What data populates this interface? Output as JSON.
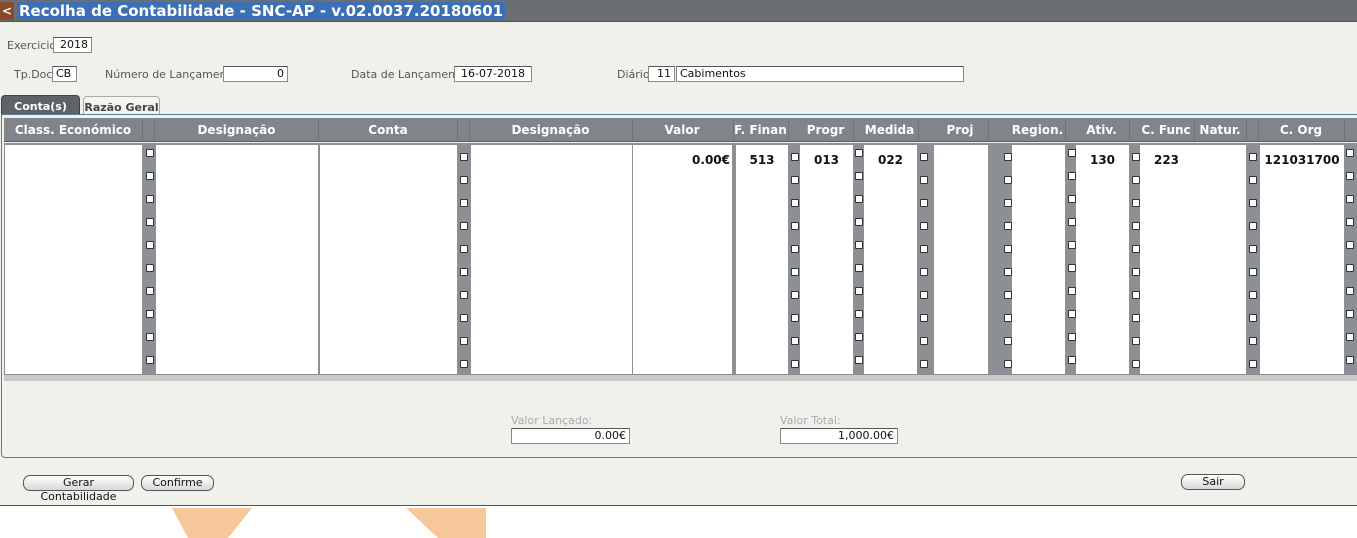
{
  "window": {
    "title": "Recolha de Contabilidade - SNC-AP - v.02.0037.20180601",
    "back_glyph": "<"
  },
  "form": {
    "exercicio_label": "Exercicio",
    "exercicio_value": "2018",
    "tpdoc_label": "Tp.Doc.",
    "tpdoc_value": "CB",
    "numero_label": "Número de Lançamento:",
    "numero_value": "0",
    "data_label": "Data de Lançamento:",
    "data_value": "16-07-2018",
    "diario_label": "Diário:",
    "diario_code": "11",
    "diario_name": "Cabimentos"
  },
  "tabs": [
    {
      "label": "Conta(s)",
      "active": true
    },
    {
      "label": "Razão Geral",
      "active": false
    }
  ],
  "grid": {
    "columns": [
      "Class. Económico",
      "Designação",
      "Conta",
      "Designação",
      "Valor",
      "F. Finan",
      "Progr",
      "Medida",
      "Proj",
      "Region.",
      "Ativ.",
      "C. Func",
      "Natur.",
      "C. Org"
    ],
    "row1": {
      "valor": "0.00€",
      "f_finan": "513",
      "progr": "013",
      "medida": "022",
      "ativ": "130",
      "c_func": "223",
      "c_org": "121031700"
    }
  },
  "totals": {
    "valor_lancado_label": "Valor Lançado:",
    "valor_lancado_value": "0.00€",
    "valor_total_label": "Valor Total:",
    "valor_total_value": "1,000.00€"
  },
  "buttons": {
    "gerar": "Gerar Contabilidade",
    "confirme": "Confirme",
    "sair": "Sair"
  },
  "colors": {
    "title_highlight": "#3b6fb6",
    "grid_header": "#80858b",
    "panel_bg": "#f1f1ec",
    "accent_orange": "#f7c79c"
  }
}
